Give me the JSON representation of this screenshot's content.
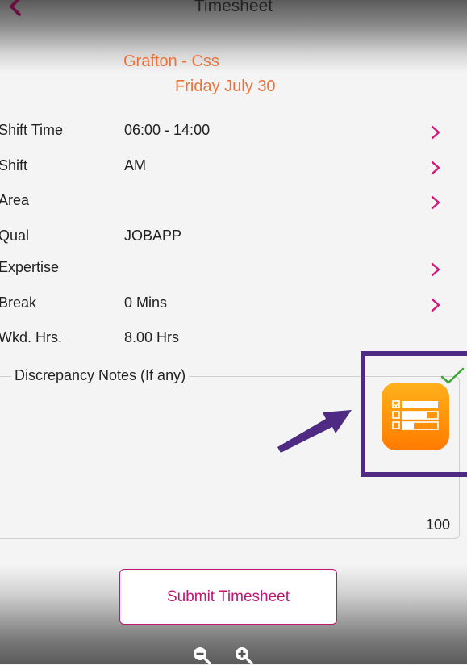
{
  "header": {
    "title": "Timesheet",
    "back_icon": "chevron-left-icon"
  },
  "shift_info": {
    "location": "Grafton - Css",
    "date": "Friday July 30"
  },
  "rows": [
    {
      "label": "Shift Time",
      "value": "06:00 - 14:00",
      "chevron": true
    },
    {
      "label": "Shift",
      "value": "AM",
      "chevron": true
    },
    {
      "label": "Area",
      "value": "",
      "chevron": true
    },
    {
      "label": "Qual",
      "value": "JOBAPP",
      "chevron": false
    },
    {
      "label": "Expertise",
      "value": "",
      "chevron": true
    },
    {
      "label": "Break",
      "value": "0 Mins",
      "chevron": true
    },
    {
      "label": "Wkd. Hrs.",
      "value": "8.00 Hrs",
      "chevron": false
    }
  ],
  "notes": {
    "label": "Discrepancy Notes (If any)",
    "char_count": "100"
  },
  "overlay": {
    "app_icon": "form-checklist-icon",
    "check_icon": "checkmark-icon",
    "arrow_icon": "arrow-icon",
    "highlight_color": "#4e2a83"
  },
  "footer": {
    "submit_label": "Submit Timesheet",
    "zoom_out_icon": "zoom-out-icon",
    "zoom_in_icon": "zoom-in-icon"
  },
  "colors": {
    "accent": "#c0186f",
    "orange": "#e8743b"
  }
}
